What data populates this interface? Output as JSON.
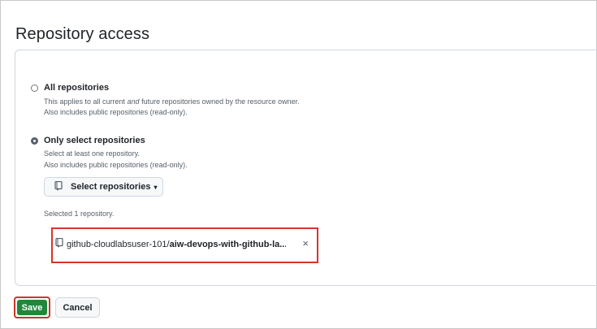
{
  "section_title": "Repository access",
  "options": {
    "all": {
      "label": "All repositories",
      "desc_line1_a": "This applies to all current ",
      "desc_line1_em": "and",
      "desc_line1_b": " future repositories owned by the resource owner.",
      "desc_line2": "Also includes public repositories (read-only).",
      "checked": false
    },
    "select": {
      "label": "Only select repositories",
      "desc_line1": "Select at least one repository.",
      "desc_line2": "Also includes public repositories (read-only).",
      "checked": true
    }
  },
  "select_button": {
    "label": "Select repositories",
    "icon": "repo-icon",
    "caret": "▾"
  },
  "selected_note": "Selected 1 repository.",
  "selected_repo": {
    "owner": "github-cloudlabsuser-101/",
    "name": "aiw-devops-with-github-la...",
    "icon": "repo-icon",
    "remove": "×"
  },
  "actions": {
    "save": "Save",
    "cancel": "Cancel"
  },
  "colors": {
    "primary": "#1f883d",
    "highlight": "#d9342b"
  }
}
